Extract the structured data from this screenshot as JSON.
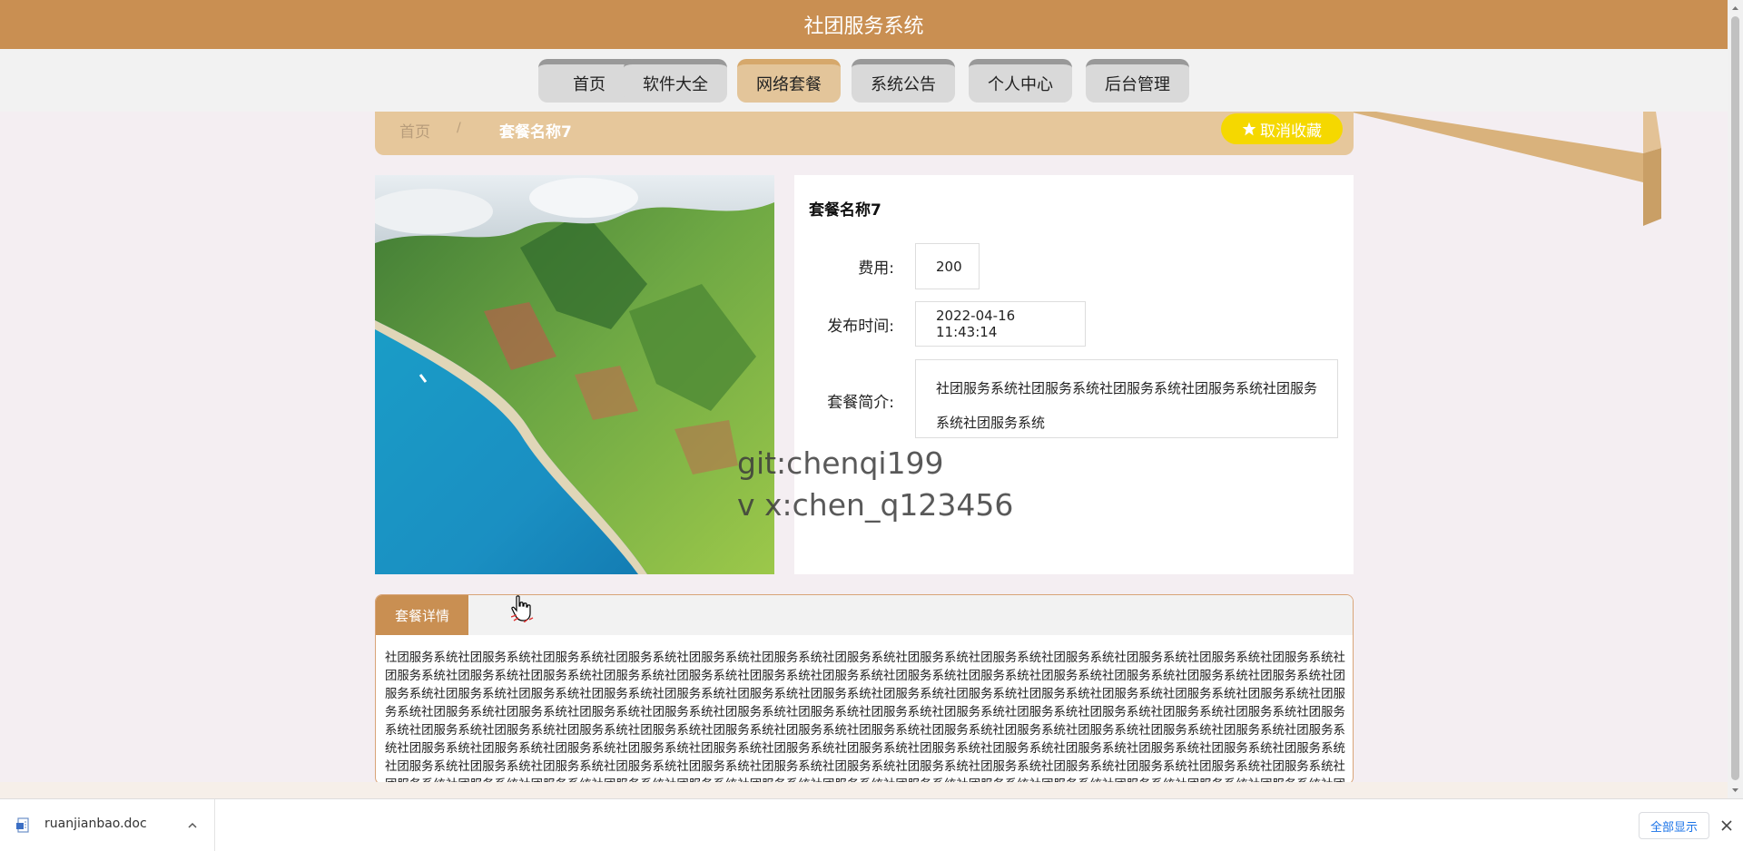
{
  "header": {
    "title": "社团服务系统"
  },
  "nav": {
    "items": [
      {
        "label": "首页"
      },
      {
        "label": "软件大全"
      },
      {
        "label": "网络套餐"
      },
      {
        "label": "系统公告"
      },
      {
        "label": "个人中心"
      },
      {
        "label": "后台管理"
      }
    ],
    "active_index": 2
  },
  "breadcrumb": {
    "home": "首页",
    "separator": "/",
    "current": "套餐名称7"
  },
  "favorite_button": {
    "label": "取消收藏",
    "icon": "star-icon"
  },
  "detail": {
    "name": "套餐名称7",
    "fields": [
      {
        "label": "费用:",
        "value": "200"
      },
      {
        "label": "发布时间:",
        "value": "2022-04-16 11:43:14"
      },
      {
        "label": "套餐简介:",
        "value": "社团服务系统社团服务系统社团服务系统社团服务系统社团服务系统社团服务系统"
      }
    ]
  },
  "watermark": {
    "line1": "git:chenqi199",
    "line2": "v x:chen_q123456"
  },
  "tabs": {
    "active": "套餐详情"
  },
  "description": "社团服务系统社团服务系统社团服务系统社团服务系统社团服务系统社团服务系统社团服务系统社团服务系统社团服务系统社团服务系统社团服务系统社团服务系统社团服务系统社团服务系统社团服务系统社团服务系统社团服务系统社团服务系统社团服务系统社团服务系统社团服务系统社团服务系统社团服务系统社团服务系统社团服务系统社团服务系统社团服务系统社团服务系统社团服务系统社团服务系统社团服务系统社团服务系统社团服务系统社团服务系统社团服务系统社团服务系统社团服务系统社团服务系统社团服务系统社团服务系统社团服务系统社团服务系统社团服务系统社团服务系统社团服务系统社团服务系统社团服务系统社团服务系统社团服务系统社团服务系统社团服务系统社团服务系统社团服务系统社团服务系统社团服务系统社团服务系统社团服务系统社团服务系统社团服务系统社团服务系统社团服务系统社团服务系统社团服务系统社团服务系统社团服务系统社团服务系统社团服务系统社团服务系统社团服务系统社团服务系统社团服务系统社团服务系统社团服务系统社团服务系统社团服务系统社团服务系统社团服务系统社团服务系统社团服务系统社团服务系统社团服务系统社团服务系统社团服务系统社团服务系统社团服务系统社团服务系统社团服务系统社团服务系统社团服务系统社团服务系统社团服务系统社团服务系统社团服务系统社团服务系统社团服务系统社团服务系统社团服务系统社团服务系统社团服务系统社团服务系统社团服务系统社团服务系统社团服务系统社团服务系统社团服务系统社团服务系统社团服务系统社团服务系统",
  "download_bar": {
    "file_name": "ruanjianbao.doc",
    "show_all": "全部显示"
  },
  "colors": {
    "header": "#c98f52",
    "breadcrumb_bg": "#e6c79b",
    "favorite_button": "#f5d800",
    "tab_active": "#c98f52"
  }
}
